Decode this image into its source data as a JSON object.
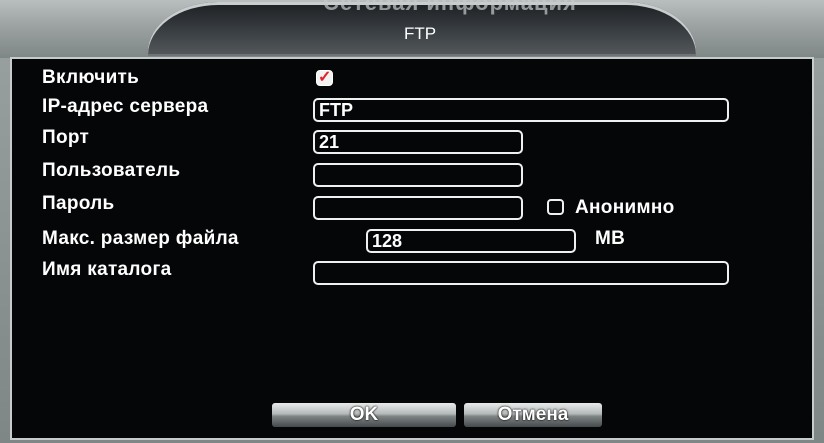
{
  "window": {
    "title": "FTP",
    "title_behind": "Сетевая информация"
  },
  "form": {
    "enable": {
      "label": "Включить",
      "checked": true
    },
    "server_ip": {
      "label": "IP-адрес сервера",
      "value": "FTP"
    },
    "port": {
      "label": "Порт",
      "value": "21"
    },
    "user": {
      "label": "Пользователь",
      "value": ""
    },
    "password": {
      "label": "Пароль",
      "value": ""
    },
    "anonymous": {
      "label": "Анонимно",
      "checked": false
    },
    "max_file_size": {
      "label": "Макс. размер файла",
      "value": "128",
      "unit": "MB"
    },
    "directory": {
      "label": "Имя каталога",
      "value": ""
    }
  },
  "buttons": {
    "ok": "OK",
    "cancel": "Отмена"
  },
  "colors": {
    "panel_bg": "#050608",
    "frame_gray": "#9aa2a2",
    "check_red": "#e0202a",
    "text": "#ffffff"
  }
}
